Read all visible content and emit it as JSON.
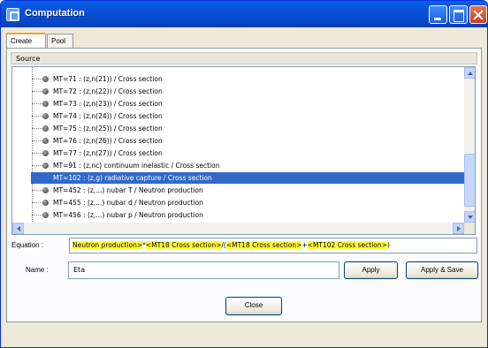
{
  "window": {
    "title": "Computation"
  },
  "tabs": [
    {
      "label": "Create",
      "active": true
    },
    {
      "label": "Pool",
      "active": false
    }
  ],
  "source": {
    "header": "Source"
  },
  "list": {
    "items": [
      {
        "text": "MT=71 : (z,n(21)) / Cross section",
        "selected": false
      },
      {
        "text": "MT=72 : (z,n(22)) / Cross section",
        "selected": false
      },
      {
        "text": "MT=73 : (z,n(23)) / Cross section",
        "selected": false
      },
      {
        "text": "MT=74 : (z,n(24)) / Cross section",
        "selected": false
      },
      {
        "text": "MT=75 : (z,n(25)) / Cross section",
        "selected": false
      },
      {
        "text": "MT=76 : (z,n(26)) / Cross section",
        "selected": false
      },
      {
        "text": "MT=77 : (z,n(27)) / Cross section",
        "selected": false
      },
      {
        "text": "MT=91 : (z,nc) continuum inelastic / Cross section",
        "selected": false
      },
      {
        "text": "MT=102 : (z,g) radiative capture / Cross section",
        "selected": true
      },
      {
        "text": "MT=452 : (z,...) nubar T / Neutron production",
        "selected": false
      },
      {
        "text": "MT=455 : (z,...) nubar d / Neutron production",
        "selected": false
      },
      {
        "text": "MT=456 : (z,...) nubar p / Neutron production",
        "selected": false
      }
    ]
  },
  "equation": {
    "label": "Equation :",
    "parts": [
      {
        "text": "Neutron production>",
        "highlight": true
      },
      {
        "text": "*",
        "highlight": false
      },
      {
        "text": "<MT18 Cross section>",
        "highlight": true
      },
      {
        "text": "/(",
        "highlight": false
      },
      {
        "text": "<MT18 Cross section>",
        "highlight": true
      },
      {
        "text": "+",
        "highlight": false
      },
      {
        "text": "<MT102 Cross section>",
        "highlight": true
      },
      {
        "text": ")",
        "highlight": false
      }
    ]
  },
  "name": {
    "label": "Name :",
    "value": "Eta"
  },
  "buttons": {
    "apply": "Apply",
    "apply_save": "Apply & Save",
    "close": "Close"
  },
  "colors": {
    "titlebar": "#0a5fe6",
    "selection": "#316ac5",
    "highlight": "#ffff3a"
  }
}
